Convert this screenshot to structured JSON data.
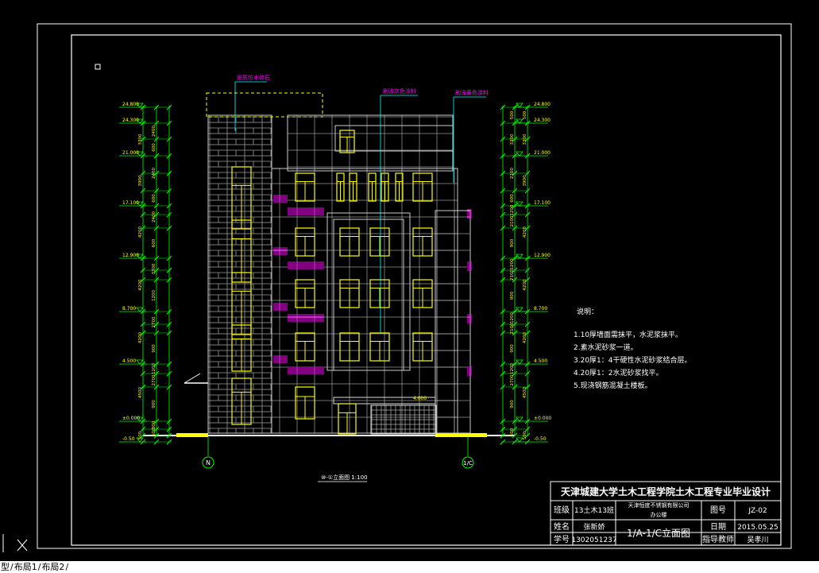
{
  "drawing": {
    "elevation_labels_left": [
      "24.800",
      "24.300",
      "21.000",
      "17.100",
      "12.900",
      "8.700",
      "4.500",
      "±0.000",
      "-0.50"
    ],
    "elevation_labels_right": [
      "24.800",
      "24.300",
      "21.000",
      "17.100",
      "12.900",
      "8.700",
      "4.500",
      "±0.000",
      "-0.50"
    ],
    "dim_left_outer": [
      "3300",
      "3900",
      "4200",
      "4200",
      "4200",
      "4500",
      "500"
    ],
    "dim_left_inner": [
      "2400",
      "600",
      "2400",
      "600",
      "2400",
      "600",
      "3300",
      "1200",
      "2700",
      "900",
      "1200",
      "2700",
      "900",
      "300",
      "500"
    ],
    "dim_right_outer": [
      "500",
      "3300",
      "3900",
      "4200",
      "4200",
      "4200",
      "4500",
      "500"
    ],
    "dim_right_inner": [
      "500",
      "3300",
      "2100",
      "600",
      "1200",
      "2100",
      "900",
      "1200",
      "2100",
      "900",
      "1200",
      "2100",
      "900",
      "1200",
      "2700",
      "900",
      "500"
    ],
    "material_labels": [
      "瓷质仿木砖石",
      "刷浅灰色涂料",
      "刷浅黄色涂料"
    ],
    "canopy_level": "4.000",
    "axis_left": "N",
    "axis_right": "1/C",
    "view_title": "⑩-①立面图 1:100",
    "notes_title": "说明：",
    "notes": [
      "1.10厚墙面需抹平，水泥浆抹平。",
      "2.素水泥砂浆一道。",
      "3.20厚1：4干硬性水泥砂浆结合层。",
      "4.20厚1：2水泥砂浆找平。",
      "5.现浇钢筋混凝土楼板。"
    ]
  },
  "title_block": {
    "heading": "天津城建大学土木工程学院土木工程专业毕业设计",
    "class_label": "班级",
    "class_value": "13土木13班",
    "company": "天津恒度不锈钢有限公司",
    "building": "办公楼",
    "drawing_no_label": "图号",
    "drawing_no": "JZ-02",
    "name_label": "姓名",
    "name_value": "张新娇",
    "drawing_name": "1/A-1/C立面图",
    "date_label": "日期",
    "date_value": "2015.05.25",
    "student_id_label": "学号",
    "student_id": "1302051237",
    "advisor_label": "指导教师",
    "advisor_value": "吴孝川"
  },
  "tabs": [
    "型",
    "布局1",
    "布局2"
  ],
  "colors": {
    "background": "#000000",
    "frame": "#ffffff",
    "window": "#ffff00",
    "railing": "#ff00ff",
    "grid": "#cccccc",
    "brick": "#b0b0b0",
    "dim": "#00ff00",
    "leader": "#00ffff"
  }
}
